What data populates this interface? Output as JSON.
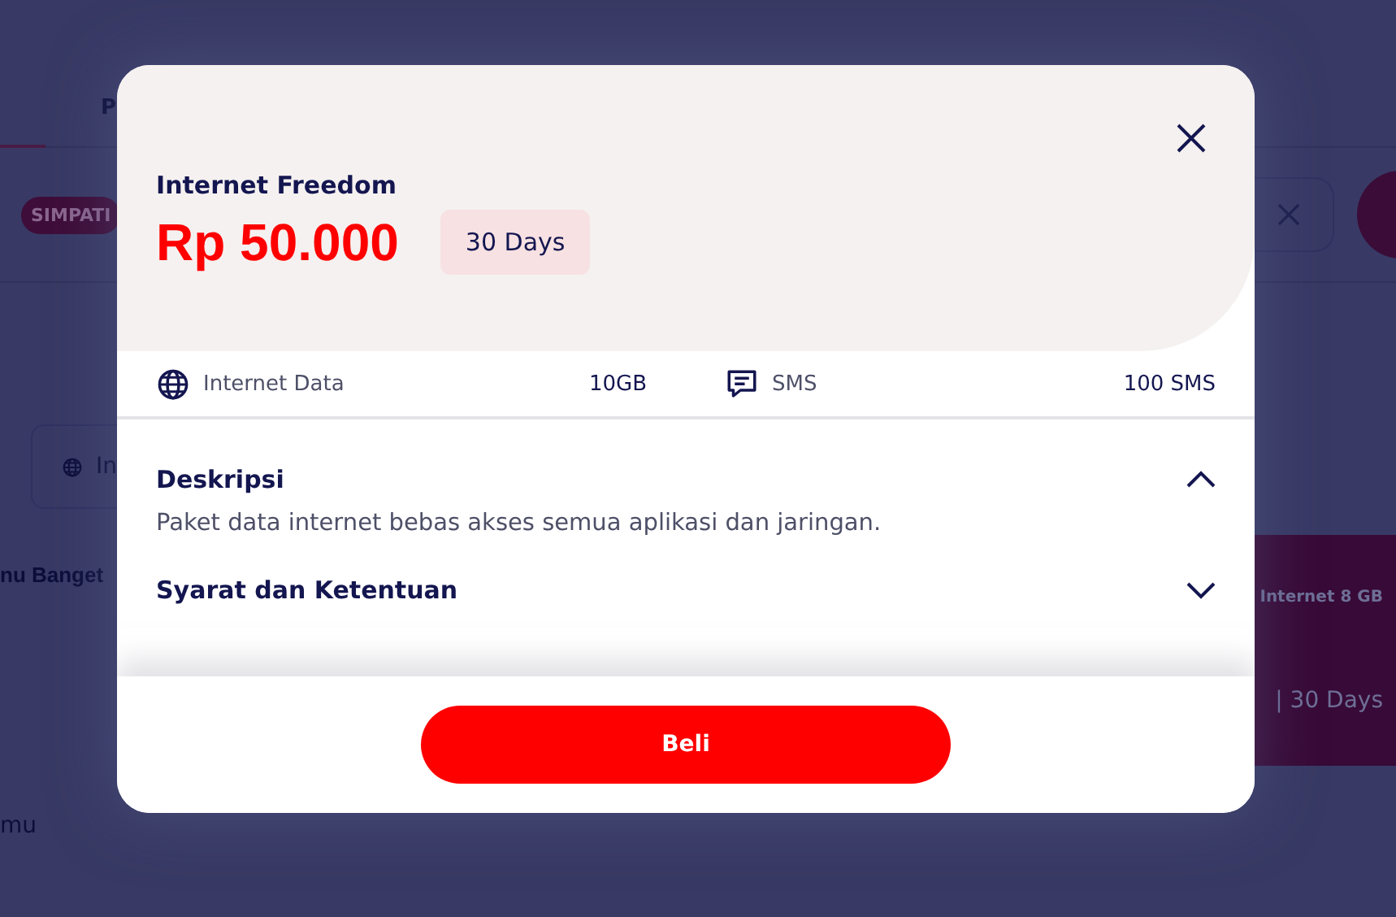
{
  "background": {
    "tab": "P",
    "badge": "SIMPATI",
    "chip": "In",
    "section_title": "nu Banget",
    "caption": "mu",
    "card": {
      "title": "Internet 8 GB",
      "validity": "| 30 Days"
    }
  },
  "modal": {
    "name": "Internet Freedom",
    "price": "Rp 50.000",
    "duration": "30 Days",
    "benefits": [
      {
        "kind": "internet",
        "label": "Internet Data",
        "value": "10GB"
      },
      {
        "kind": "sms",
        "label": "SMS",
        "value": "100 SMS"
      }
    ],
    "sections": [
      {
        "title": "Deskripsi",
        "expanded": true,
        "body": "Paket data internet bebas akses semua aplikasi dan jaringan."
      },
      {
        "title": "Syarat dan Ketentuan",
        "expanded": false
      }
    ],
    "button": "Beli"
  }
}
